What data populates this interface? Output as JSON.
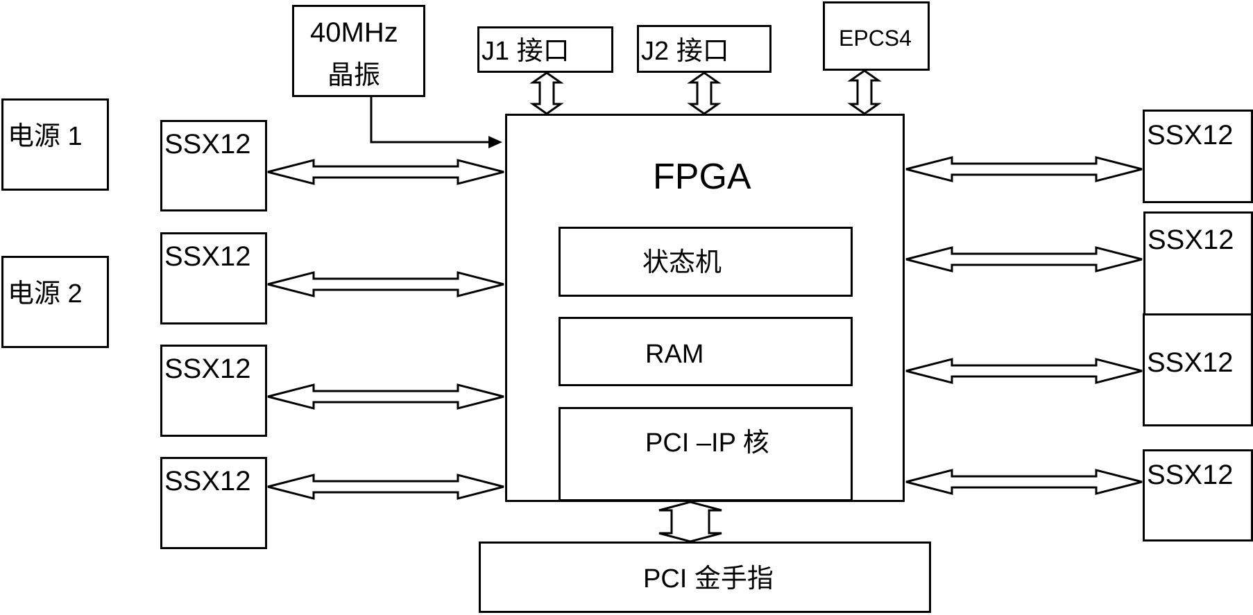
{
  "diagram": {
    "oscillator": {
      "line1": "40MHz",
      "line2": "晶振"
    },
    "j1": "J1 接口",
    "j2": "J2 接口",
    "epcs": "EPCS4",
    "power1": "电源 1",
    "power2": "电源 2",
    "fpga": {
      "title": "FPGA",
      "blocks": [
        "状态机",
        "RAM",
        "PCI –IP 核"
      ]
    },
    "pci_edge": "PCI 金手指",
    "left_ssx": [
      "SSX12",
      "SSX12",
      "SSX12",
      "SSX12"
    ],
    "right_ssx": [
      "SSX12",
      "SSX12",
      "SSX12",
      "SSX12"
    ]
  }
}
